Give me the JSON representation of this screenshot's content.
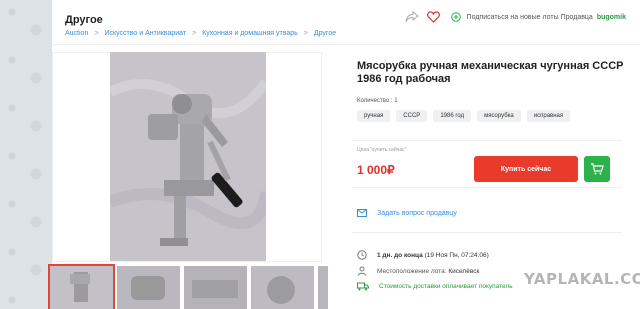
{
  "header": {
    "category_title": "Другое",
    "breadcrumb": [
      "Auction",
      "Искусство и Антиквариат",
      "Кухонная и домашняя утварь",
      "Другое"
    ],
    "subscribe_text": "Подписаться на новые лоты Продавца",
    "seller_name": "bugomik"
  },
  "product": {
    "title": "Мясорубка ручная механическая чугунная СССР 1986 год рабочая",
    "quantity_label": "Количество : 1",
    "tags": [
      "ручная",
      "СССР",
      "1986 год",
      "мясорубка",
      "исправная"
    ]
  },
  "buy": {
    "label": "Цена \"купить сейчас\"",
    "price": "1 000₽",
    "button_label": "Купить сейчас"
  },
  "ask_seller": "Задать вопрос продавцу",
  "details": {
    "time_left_bold": "1 дн. до конца",
    "time_left_date": "(19 Ноя Пн, 07:24:06)",
    "location_label": "Местоположение лота:",
    "location_value": "Киселёвск",
    "shipping_text": "Стоимость доставки оплачивает покупатель"
  },
  "watermark": "YAPLAKAL.COM",
  "colors": {
    "accent_red": "#ea3a2c",
    "price_red": "#e0302a",
    "green": "#2bb34a",
    "link_blue": "#3a8fd6"
  }
}
